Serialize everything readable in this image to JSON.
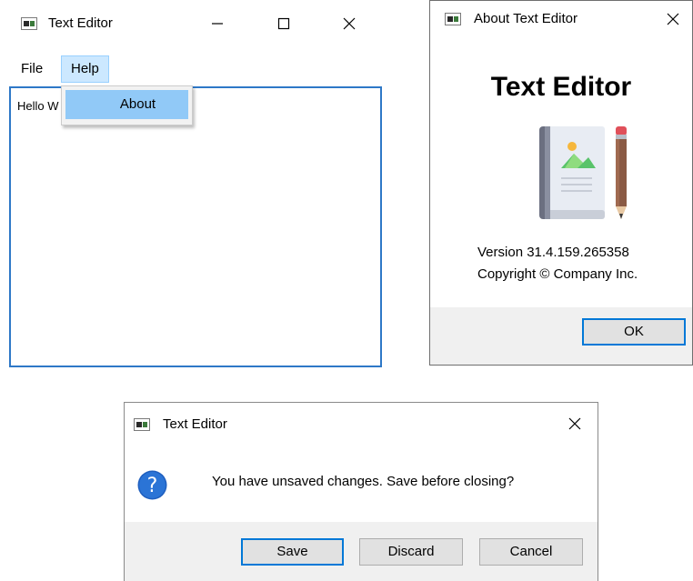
{
  "main_window": {
    "title": "Text Editor",
    "menu": [
      "File",
      "Help"
    ],
    "active_menu": "Help",
    "dropdown_items": [
      "About"
    ],
    "editor_text": "Hello W"
  },
  "about_window": {
    "title": "About Text Editor",
    "heading": "Text Editor",
    "version": "Version 31.4.159.265358",
    "copyright": "Copyright © Company Inc.",
    "ok_label": "OK"
  },
  "confirm_dialog": {
    "title": "Text Editor",
    "message": "You have unsaved changes. Save before closing?",
    "buttons": {
      "save": "Save",
      "discard": "Discard",
      "cancel": "Cancel"
    }
  },
  "colors": {
    "focus_border": "#2e78c7",
    "menu_highlight": "#cce8ff",
    "dropdown_highlight": "#91c9f7",
    "footer_bg": "#f0f0f0",
    "button_bg": "#e1e1e1"
  },
  "icons": [
    "app-icon",
    "minimize-icon",
    "maximize-icon",
    "close-icon",
    "book-pencil-icon",
    "question-icon"
  ]
}
